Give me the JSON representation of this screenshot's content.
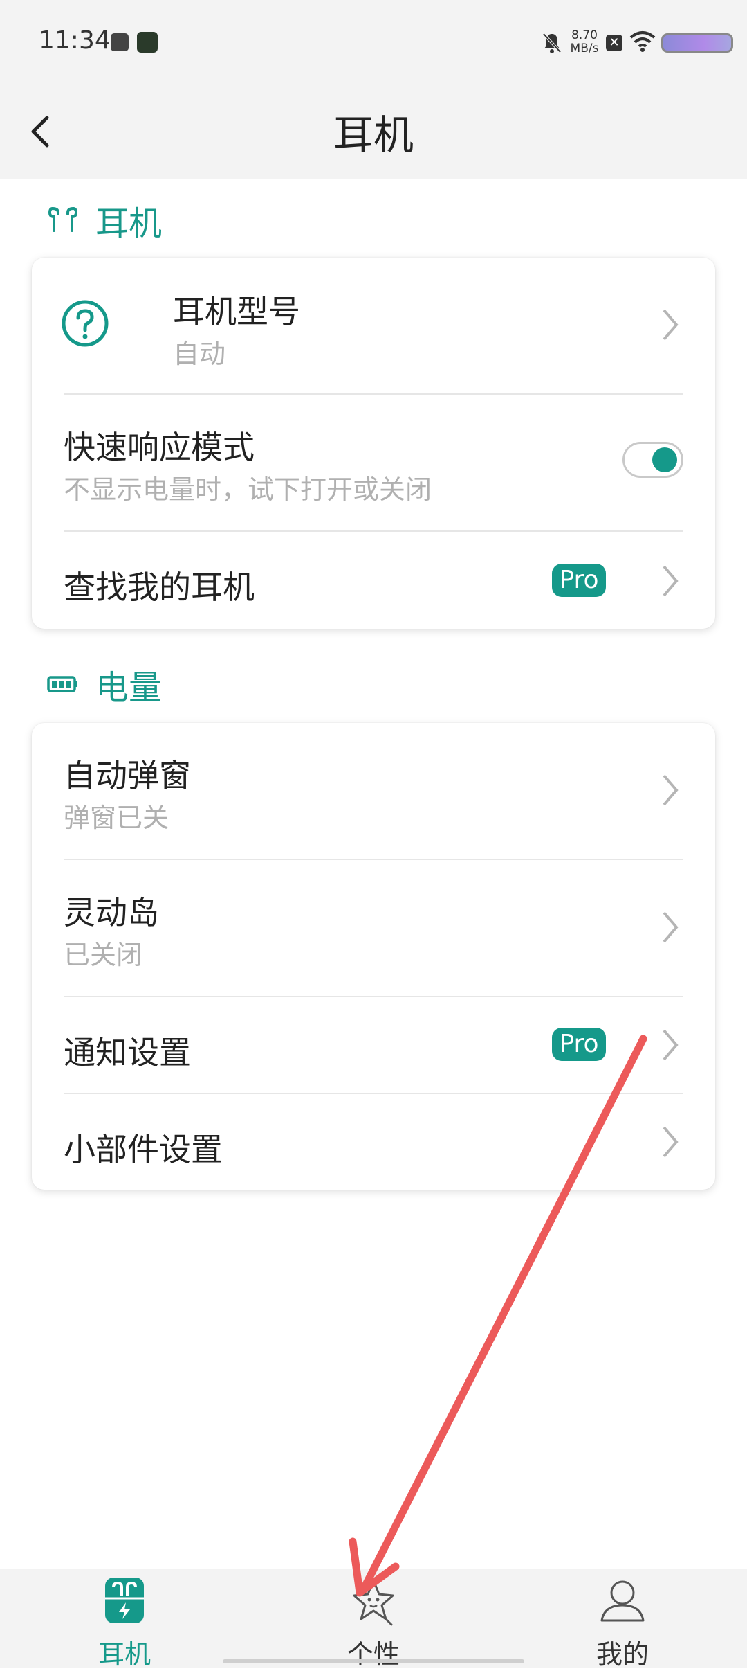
{
  "status_bar": {
    "time": "11:34",
    "net_speed_value": "8.70",
    "net_speed_unit": "MB/s"
  },
  "header": {
    "title": "耳机"
  },
  "sections": {
    "earphone": {
      "title": "耳机",
      "icon": "earbuds-icon",
      "model": {
        "title": "耳机型号",
        "value": "自动"
      },
      "fast_response": {
        "title": "快速响应模式",
        "subtitle": "不显示电量时，试下打开或关闭",
        "enabled": true
      },
      "find": {
        "title": "查找我的耳机",
        "badge": "Pro"
      }
    },
    "battery": {
      "title": "电量",
      "icon": "battery-icon",
      "popup": {
        "title": "自动弹窗",
        "value": "弹窗已关"
      },
      "island": {
        "title": "灵动岛",
        "value": "已关闭"
      },
      "notification": {
        "title": "通知设置",
        "badge": "Pro"
      },
      "widget": {
        "title": "小部件设置"
      }
    }
  },
  "nav": {
    "items": [
      {
        "label": "耳机",
        "icon": "earbuds-case-icon",
        "active": true
      },
      {
        "label": "个性",
        "icon": "star-face-icon",
        "active": false
      },
      {
        "label": "我的",
        "icon": "user-icon",
        "active": false
      }
    ]
  },
  "colors": {
    "accent": "#15998a",
    "annotation_arrow": "#ec5a5a",
    "background_bar": "#f3f3f3"
  }
}
